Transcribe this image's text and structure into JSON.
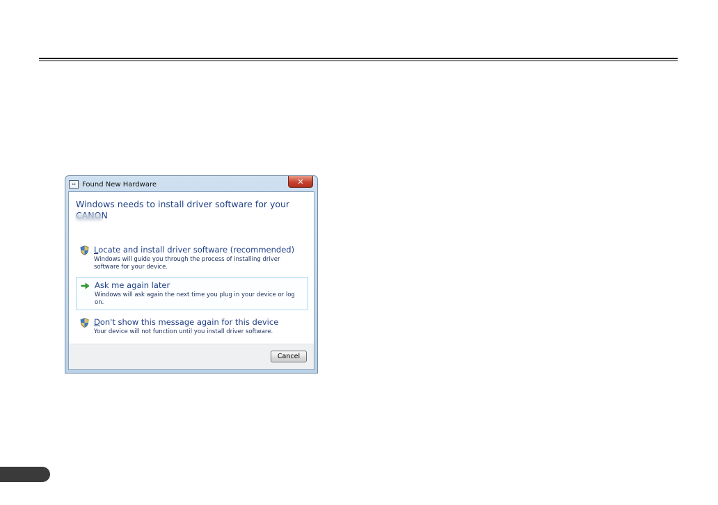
{
  "dialog": {
    "title": "Found New Hardware",
    "close_glyph": "✕",
    "heading": "Windows needs to install driver software for your CANON",
    "options": [
      {
        "accel": "L",
        "title_rest": "ocate and install driver software (recommended)",
        "description": "Windows will guide you through the process of installing driver software for your device.",
        "icon": "shield-icon"
      },
      {
        "accel": "",
        "title_rest": "Ask me again later",
        "description": "Windows will ask again the next time you plug in your device or log on.",
        "icon": "green-arrow-icon"
      },
      {
        "accel": "D",
        "title_rest": "on't show this message again for this device",
        "description": "Your device will not function until you install driver software.",
        "icon": "shield-icon"
      }
    ],
    "cancel_label": "Cancel"
  },
  "colors": {
    "heading": "#1f3f86",
    "highlight_border": "#a6d7ec",
    "close_button": "#c7432f"
  }
}
